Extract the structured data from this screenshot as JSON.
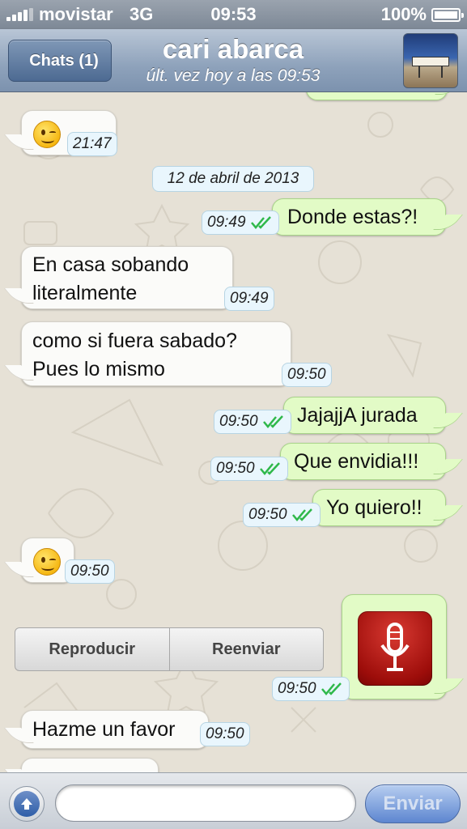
{
  "status_bar": {
    "carrier": "movistar",
    "network": "3G",
    "time": "09:53",
    "battery": "100%"
  },
  "nav": {
    "back_label": "Chats (1)",
    "contact_name": "cari abarca",
    "last_seen": "últ. vez hoy a las 09:53"
  },
  "chat": {
    "date_separator": "12 de abril de 2013",
    "messages": [
      {
        "direction": "incoming",
        "type": "emoji",
        "icon": "winking-face-icon",
        "time": "21:47"
      },
      {
        "direction": "outgoing",
        "type": "text",
        "lines": [
          "Donde estas?!"
        ],
        "time": "09:49",
        "status": "read"
      },
      {
        "direction": "incoming",
        "type": "text",
        "lines": [
          "En casa sobando",
          "literalmente"
        ],
        "time": "09:49"
      },
      {
        "direction": "incoming",
        "type": "text",
        "lines": [
          "como si fuera sabado?",
          "Pues lo mismo"
        ],
        "time": "09:50"
      },
      {
        "direction": "outgoing",
        "type": "text",
        "lines": [
          "JajajjA jurada"
        ],
        "time": "09:50",
        "status": "read"
      },
      {
        "direction": "outgoing",
        "type": "text",
        "lines": [
          "Que envidia!!!"
        ],
        "time": "09:50",
        "status": "read"
      },
      {
        "direction": "outgoing",
        "type": "text",
        "lines": [
          "Yo quiero!!"
        ],
        "time": "09:50",
        "status": "read"
      },
      {
        "direction": "incoming",
        "type": "emoji",
        "icon": "winking-face-icon",
        "time": "09:50"
      },
      {
        "direction": "outgoing",
        "type": "voice-note",
        "icon": "microphone-icon",
        "time": "09:50",
        "status": "read"
      },
      {
        "direction": "incoming",
        "type": "text",
        "lines": [
          "Hazme un favor"
        ],
        "time": "09:50"
      }
    ],
    "audio_actions": {
      "play": "Reproducir",
      "forward": "Reenviar"
    }
  },
  "input_bar": {
    "attach_icon": "upload-arrow-icon",
    "placeholder": "",
    "send_label": "Enviar"
  },
  "colors": {
    "outgoing_bubble": "#e2fbc6",
    "incoming_bubble": "#fbfbf9",
    "read_ticks": "#2fb84a",
    "nav_bar": "#8ea2bb"
  }
}
